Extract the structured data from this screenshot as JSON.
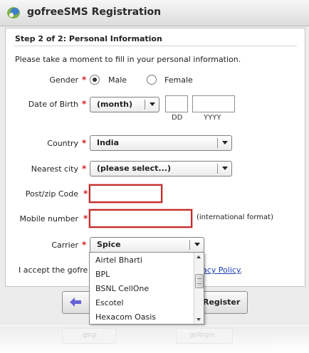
{
  "window": {
    "title": "gofreeSMS Registration"
  },
  "form": {
    "step_title": "Step 2 of 2: Personal Information",
    "intro": "Please take a moment to fill in your personal information.",
    "required_mark": "*",
    "gender": {
      "label": "Gender",
      "options": [
        "Male",
        "Female"
      ],
      "selected": "Male"
    },
    "dob": {
      "label": "Date of Birth",
      "month_value": "(month)",
      "day_value": "",
      "year_value": "",
      "day_caption": "DD",
      "year_caption": "YYYY"
    },
    "country": {
      "label": "Country",
      "value": "India"
    },
    "city": {
      "label": "Nearest city",
      "value": "(please select...)"
    },
    "postcode": {
      "label": "Post/zip Code",
      "value": ""
    },
    "mobile": {
      "label": "Mobile number",
      "value": "",
      "hint": "(international format)"
    },
    "carrier": {
      "label": "Carrier",
      "value": "Spice",
      "options_visible": [
        "Airtel Bharti",
        "BPL",
        "BSNL CellOne",
        "Escotel",
        "Hexacom Oasis"
      ]
    },
    "accept_text": "I accept the gofre",
    "privacy_link": "acy Policy",
    "accept_tail": "."
  },
  "buttons": {
    "register": "Register"
  },
  "reflection": {
    "back": "gsrp",
    "next": "golbrpis"
  },
  "colors": {
    "required": "#d21f1f",
    "error_border": "#c42a2a",
    "link": "#1a3fb0",
    "back_arrow": "#6464d8"
  },
  "icons": {
    "title": "app-logo-icon",
    "back": "back-arrow-icon",
    "select_arrow": "chevron-down-icon"
  }
}
